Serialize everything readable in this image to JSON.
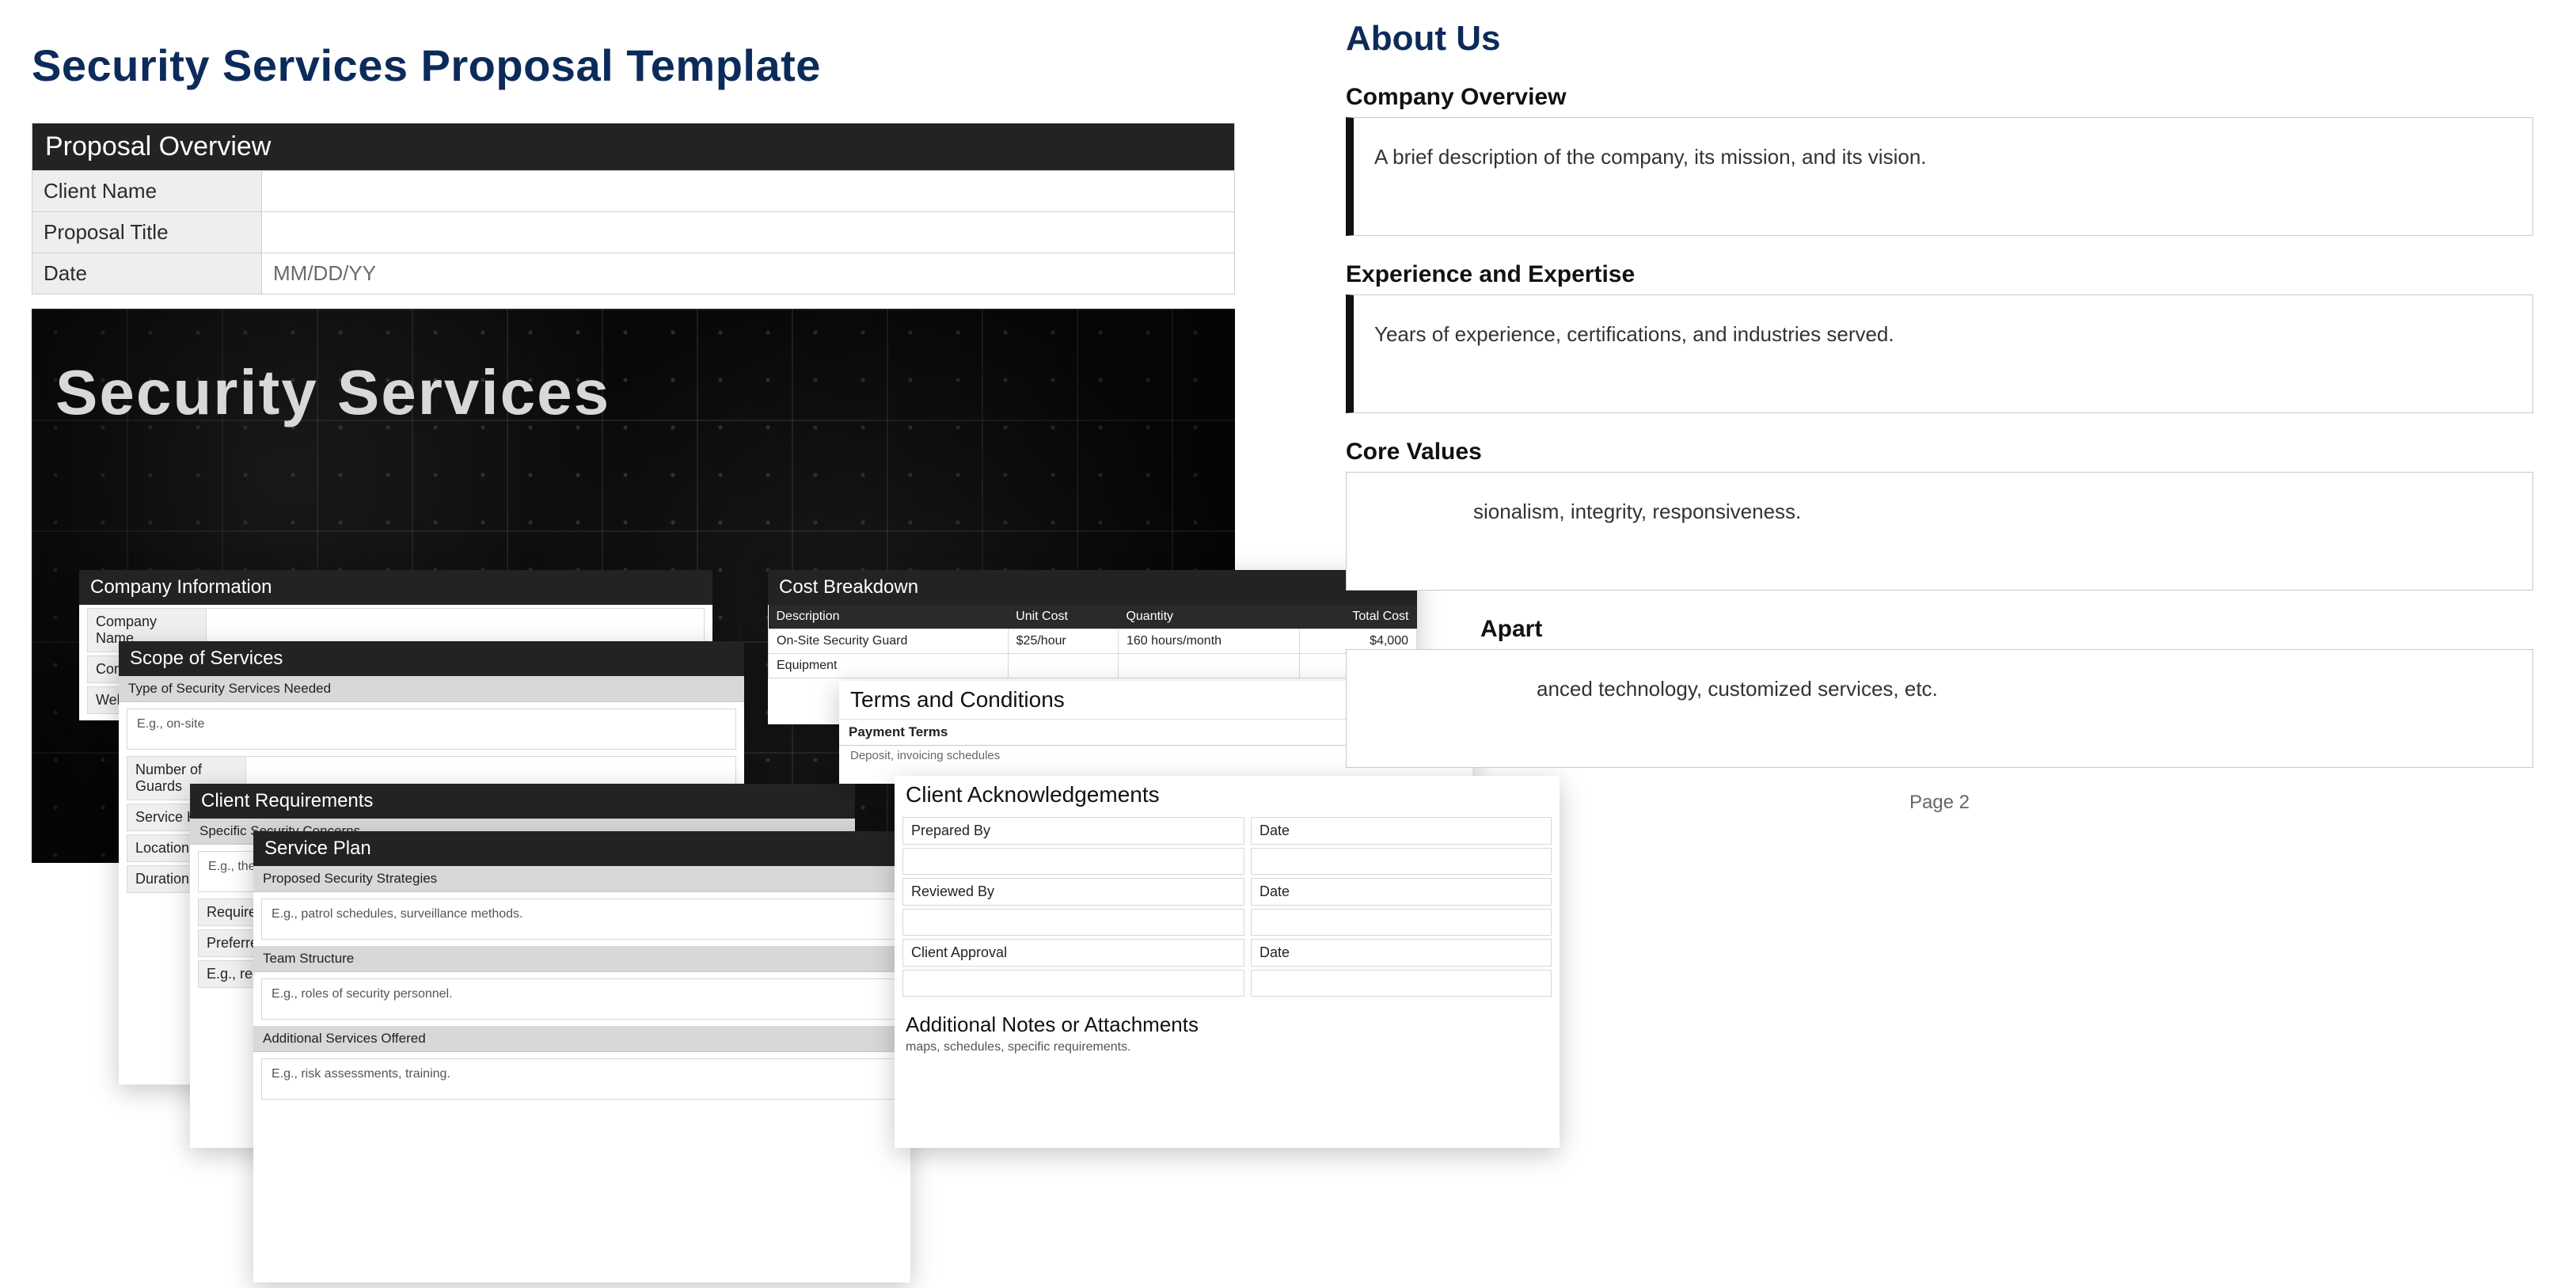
{
  "page_title": "Security Services Proposal Template",
  "overview": {
    "header": "Proposal Overview",
    "rows": [
      {
        "label": "Client Name",
        "value": ""
      },
      {
        "label": "Proposal Title",
        "value": ""
      },
      {
        "label": "Date",
        "value": "MM/DD/YY"
      }
    ]
  },
  "hero": {
    "title": "Security Services"
  },
  "minis": {
    "company": {
      "header": "Company Information",
      "rows": [
        "Company Name",
        "Contact",
        "Website"
      ]
    },
    "scope": {
      "header": "Scope of Services",
      "sub": "Type of Security Services Needed",
      "hint": "E.g., on-site",
      "fields": [
        "Number of Guards",
        "Service Hours",
        "Location",
        "Duration"
      ]
    },
    "client": {
      "header": "Client Requirements",
      "sub": "Specific Security Concerns",
      "hint": "E.g., theft",
      "fields": [
        "Required",
        "Preferred",
        "E.g., reg"
      ]
    },
    "service": {
      "header": "Service Plan",
      "blocks": [
        {
          "sub": "Proposed Security Strategies",
          "hint": "E.g., patrol schedules, surveillance methods."
        },
        {
          "sub": "Team Structure",
          "hint": "E.g., roles of security personnel."
        },
        {
          "sub": "Additional Services Offered",
          "hint": "E.g., risk assessments, training."
        }
      ]
    },
    "cost": {
      "header": "Cost Breakdown",
      "cols": [
        "Description",
        "Unit Cost",
        "Quantity",
        "Total Cost"
      ],
      "rows": [
        [
          "On-Site Security Guard",
          "$25/hour",
          "160 hours/month",
          "$4,000"
        ],
        [
          "Equipment",
          "",
          "",
          ""
        ]
      ]
    },
    "terms": {
      "header": "Terms and Conditions",
      "sub": "Payment Terms",
      "hint": "Deposit, invoicing schedules"
    },
    "ack": {
      "header": "Client Acknowledgements",
      "rows": [
        {
          "l": "Prepared By",
          "r": "Date"
        },
        {
          "l": "Reviewed By",
          "r": "Date"
        },
        {
          "l": "Client Approval",
          "r": "Date"
        }
      ],
      "notes_header": "Additional Notes or Attachments",
      "notes_hint": "maps, schedules, specific requirements."
    }
  },
  "about": {
    "title": "About Us",
    "sections": [
      {
        "heading": "Company Overview",
        "text": "A brief description of the company, its mission, and its vision."
      },
      {
        "heading": "Experience and Expertise",
        "text": "Years of experience, certifications, and industries served."
      },
      {
        "heading": "Core Values",
        "text": "sionalism, integrity, responsiveness.",
        "truncated_left": true
      },
      {
        "heading": "    Apart",
        "text": "anced technology, customized services, etc.",
        "truncated_left": true,
        "heading_truncated": true
      }
    ],
    "page_label": "Page 2"
  }
}
